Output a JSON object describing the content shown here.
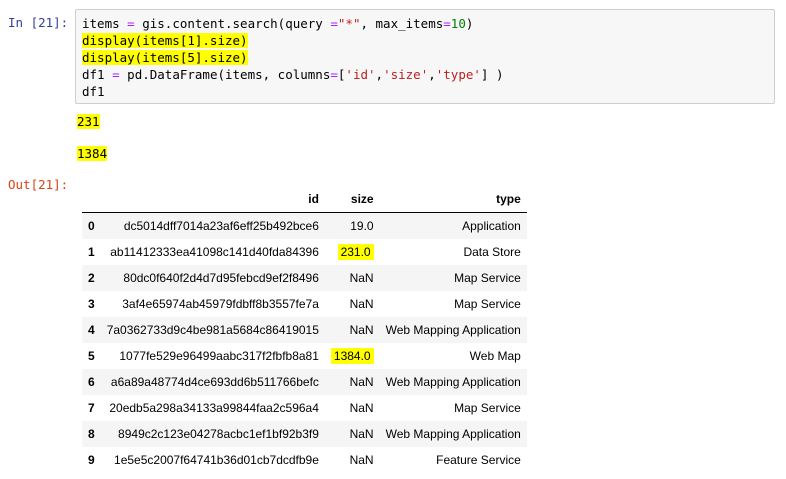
{
  "cell": {
    "input_prompt": "In [21]:",
    "output_prompt": "Out[21]:",
    "code": {
      "line1": {
        "a": "items ",
        "op1": "=",
        "b": " gis.content.search(query ",
        "op2": "=",
        "s1": "\"*\"",
        "c": ", max_items",
        "op3": "=",
        "n1": "10",
        "d": ")"
      },
      "line2": "display(items[1].size)",
      "line3": "display(items[5].size)",
      "line4": {
        "a": "df1 ",
        "op1": "=",
        "b": " pd.DataFrame(items, columns",
        "op2": "=",
        "c": "[",
        "s1": "'id'",
        "d": ",",
        "s2": "'size'",
        "e": ",",
        "s3": "'type'",
        "f": "] )"
      },
      "line5": "df1"
    },
    "outputs": [
      "231",
      "1384"
    ]
  },
  "dataframe": {
    "columns": [
      "id",
      "size",
      "type"
    ],
    "rows": [
      {
        "index": "0",
        "id": "dc5014dff7014a23af6eff25b492bce6",
        "size": "19.0",
        "type": "Application",
        "highlight": false
      },
      {
        "index": "1",
        "id": "ab11412333ea41098c141d40fda84396",
        "size": "231.0",
        "type": "Data Store",
        "highlight": true
      },
      {
        "index": "2",
        "id": "80dc0f640f2d4d7d95febcd9ef2f8496",
        "size": "NaN",
        "type": "Map Service",
        "highlight": false
      },
      {
        "index": "3",
        "id": "3af4e65974ab45979fdbff8b3557fe7a",
        "size": "NaN",
        "type": "Map Service",
        "highlight": false
      },
      {
        "index": "4",
        "id": "7a0362733d9c4be981a5684c86419015",
        "size": "NaN",
        "type": "Web Mapping Application",
        "highlight": false
      },
      {
        "index": "5",
        "id": "1077fe529e96499aabc317f2fbfb8a81",
        "size": "1384.0",
        "type": "Web Map",
        "highlight": true
      },
      {
        "index": "6",
        "id": "a6a89a48774d4ce693dd6b511766befc",
        "size": "NaN",
        "type": "Web Mapping Application",
        "highlight": false
      },
      {
        "index": "7",
        "id": "20edb5a298a34133a99844faa2c596a4",
        "size": "NaN",
        "type": "Map Service",
        "highlight": false
      },
      {
        "index": "8",
        "id": "8949c2c123e04278acbc1ef1bf92b3f9",
        "size": "NaN",
        "type": "Web Mapping Application",
        "highlight": false
      },
      {
        "index": "9",
        "id": "1e5e5c2007f64741b36d01cb7dcdfb9e",
        "size": "NaN",
        "type": "Feature Service",
        "highlight": false
      }
    ]
  },
  "colors": {
    "highlight": "#ffff00",
    "input_prompt": "#303f9f",
    "output_prompt": "#d84315",
    "string": "#ba2121",
    "number": "#008000",
    "operator": "#aa22ff"
  }
}
